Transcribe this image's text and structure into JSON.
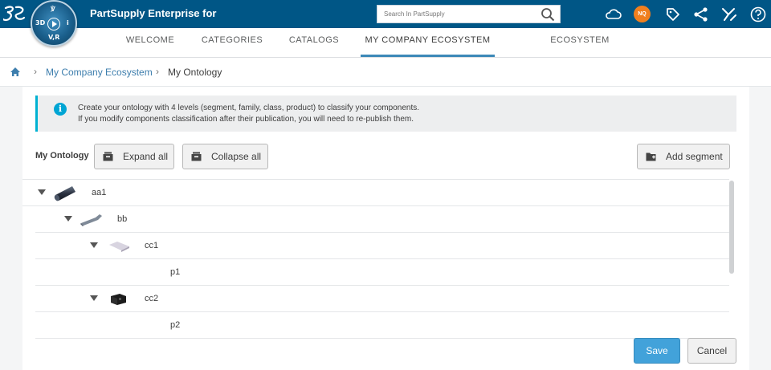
{
  "header": {
    "app_title": "PartSupply Enterprise for",
    "compass": {
      "top_label": "3D",
      "right_label": "i",
      "bottom_label": "V,R"
    },
    "avatar_initials": "NQ",
    "brand_color": "#005686",
    "avatar_color": "#f07f1e",
    "icons": [
      "cloud-icon",
      "avatar",
      "tag-icon",
      "share-icon",
      "tools-icon",
      "help-icon"
    ]
  },
  "search": {
    "placeholder": "Search In PartSupply",
    "value": ""
  },
  "nav": {
    "tabs": [
      {
        "label": "Welcome"
      },
      {
        "label": "Categories"
      },
      {
        "label": "Catalogs"
      },
      {
        "label": "My Company Ecosystem",
        "active": true
      },
      {
        "label": "Ecosystem Performances"
      }
    ]
  },
  "breadcrumb": {
    "link": "My Company Ecosystem",
    "current": "My Ontology"
  },
  "info": {
    "line1": "Create your ontology with 4 levels (segment, family, class, product) to classify your components.",
    "line2": "If you modify components classification after their publication, you will need to re-publish them.",
    "accent_color": "#00b1d2"
  },
  "toolbar": {
    "title": "My Ontology",
    "expand_label": "Expand all",
    "collapse_label": "Collapse all",
    "add_segment_label": "Add segment"
  },
  "tree": {
    "rows": [
      {
        "label": "aa1",
        "level": "segment",
        "expanded": true
      },
      {
        "label": "bb",
        "level": "family",
        "expanded": true
      },
      {
        "label": "cc1",
        "level": "class",
        "expanded": true
      },
      {
        "label": "p1",
        "level": "product"
      },
      {
        "label": "cc2",
        "level": "class",
        "expanded": true
      },
      {
        "label": "p2",
        "level": "product"
      }
    ]
  },
  "footer": {
    "save_label": "Save",
    "cancel_label": "Cancel",
    "save_color": "#42a2da"
  }
}
